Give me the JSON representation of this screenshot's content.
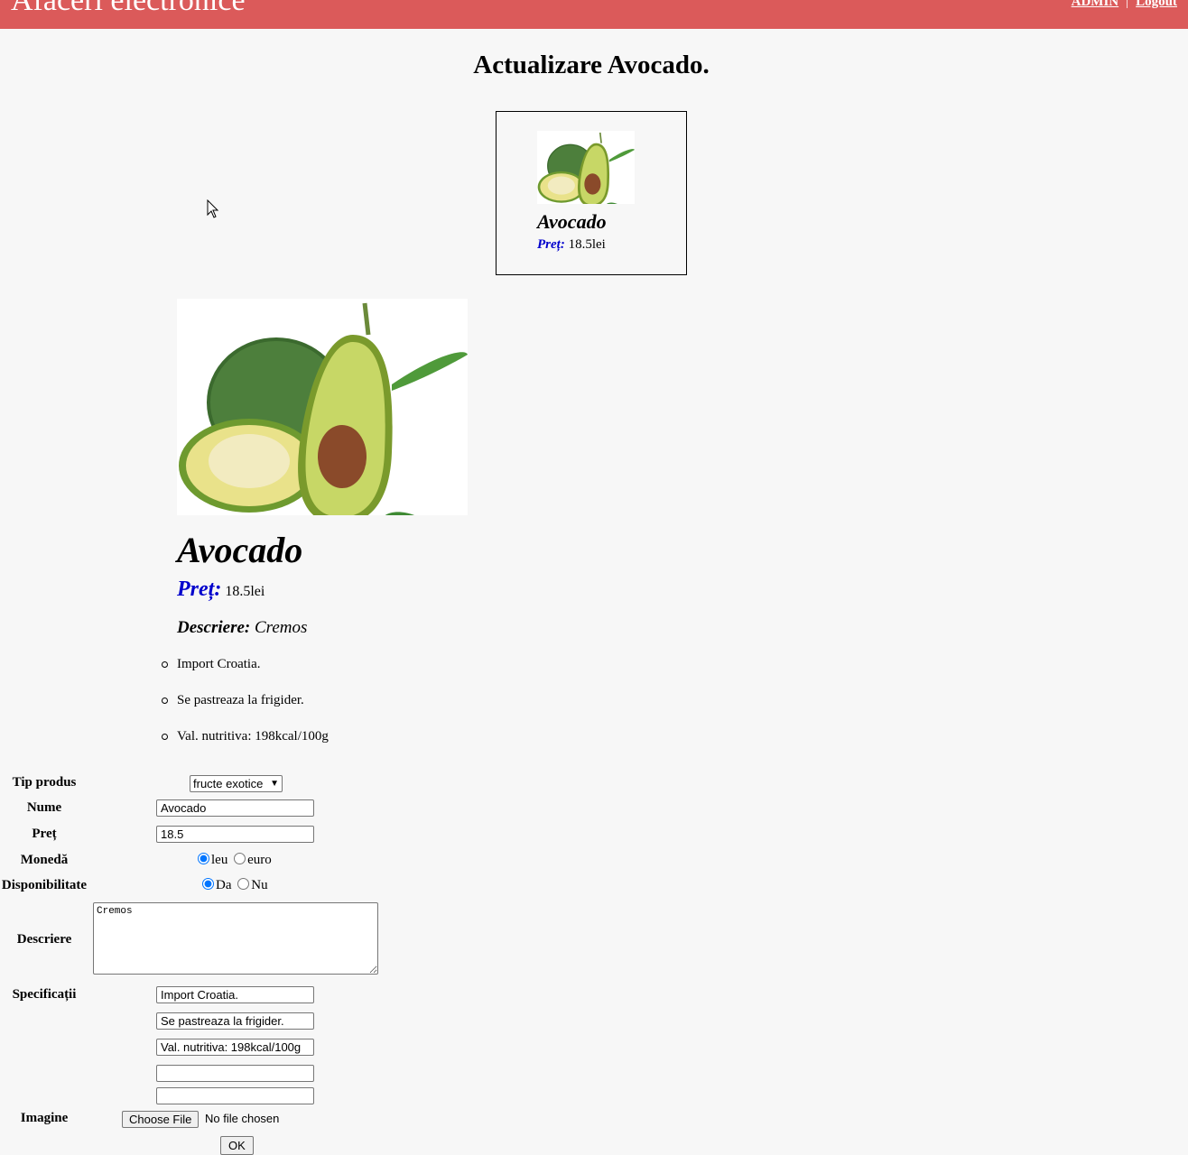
{
  "header": {
    "title": "Afaceri electronice",
    "admin_link": "ADMIN",
    "separator": "|",
    "logout_link": "Logout",
    "bg_color": "#db5a5a"
  },
  "page": {
    "heading": "Actualizare Avocado."
  },
  "card": {
    "name": "Avocado",
    "price_label": "Preț:",
    "price_value": "18.5lei"
  },
  "product": {
    "name": "Avocado",
    "price_label": "Preț:",
    "price_value": "18.5lei",
    "description_label": "Descriere:",
    "description_value": "Cremos",
    "specs": [
      "Import Croatia.",
      "Se pastreaza la frigider.",
      "Val. nutritiva: 198kcal/100g"
    ]
  },
  "form": {
    "type_label": "Tip produs",
    "type_selected": "fructe exotice",
    "name_label": "Nume",
    "name_value": "Avocado",
    "price_label": "Preț",
    "price_value": "18.5",
    "currency_label": "Monedă",
    "currency_options": [
      "leu",
      "euro"
    ],
    "currency_selected": "leu",
    "availability_label": "Disponibilitate",
    "availability_options": [
      "Da",
      "Nu"
    ],
    "availability_selected": "Da",
    "description_label": "Descriere",
    "description_value": "Cremos",
    "specs_label": "Specificații",
    "specs_values": [
      "Import Croatia.",
      "Se pastreaza la frigider.",
      "Val. nutritiva: 198kcal/100g",
      "",
      ""
    ],
    "image_label": "Imagine",
    "file_button": "Choose File",
    "file_status": "No file chosen",
    "ok_button": "OK"
  }
}
